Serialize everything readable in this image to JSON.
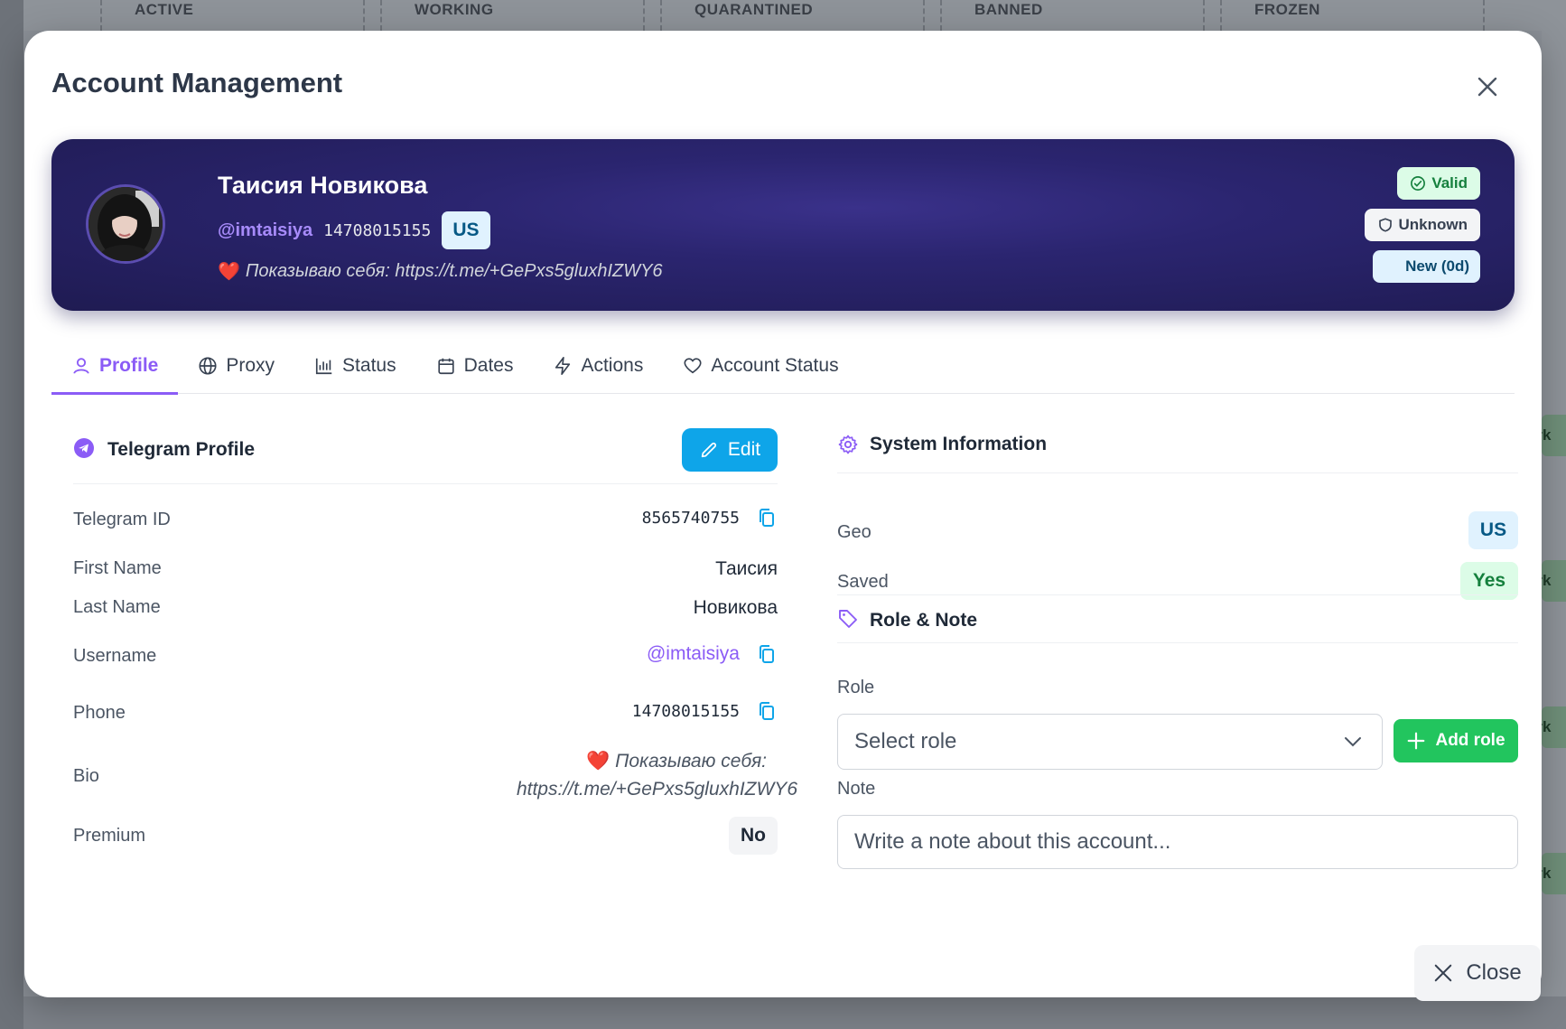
{
  "board": {
    "columns": [
      "ACTIVE",
      "WORKING",
      "QUARANTINED",
      "BANNED",
      "FROZEN"
    ],
    "side_tag": "ork"
  },
  "modal": {
    "title": "Account Management",
    "close_label": "Close"
  },
  "hero": {
    "name": "Таисия Новикова",
    "username": "@imtaisiya",
    "phone": "14708015155",
    "geo": "US",
    "bio_emoji": "❤️",
    "bio_text": "Показываю себя: https://t.me/+GePxs5gluxhIZWY6",
    "badges": {
      "valid": "Valid",
      "unknown": "Unknown",
      "new": "New (0d)"
    }
  },
  "tabs": [
    {
      "label": "Profile",
      "icon": "user-icon",
      "active": true
    },
    {
      "label": "Proxy",
      "icon": "globe-icon",
      "active": false
    },
    {
      "label": "Status",
      "icon": "bar-chart-icon",
      "active": false
    },
    {
      "label": "Dates",
      "icon": "calendar-icon",
      "active": false
    },
    {
      "label": "Actions",
      "icon": "lightning-icon",
      "active": false
    },
    {
      "label": "Account Status",
      "icon": "heart-icon",
      "active": false
    }
  ],
  "profile": {
    "section_title": "Telegram Profile",
    "edit_label": "Edit",
    "fields": {
      "telegram_id_label": "Telegram ID",
      "telegram_id": "8565740755",
      "first_name_label": "First Name",
      "first_name": "Таисия",
      "last_name_label": "Last Name",
      "last_name": "Новикова",
      "username_label": "Username",
      "username": "@imtaisiya",
      "phone_label": "Phone",
      "phone": "14708015155",
      "bio_label": "Bio",
      "bio_emoji": "❤️",
      "bio_line1": "Показываю себя:",
      "bio_line2": "https://t.me/+GePxs5gluxhIZWY6",
      "premium_label": "Premium",
      "premium": "No"
    }
  },
  "system": {
    "section_title": "System Information",
    "geo_label": "Geo",
    "geo": "US",
    "saved_label": "Saved",
    "saved": "Yes"
  },
  "role_note": {
    "section_title": "Role & Note",
    "role_label": "Role",
    "role_placeholder": "Select role",
    "add_role_label": "Add role",
    "note_label": "Note",
    "note_placeholder": "Write a note about this account..."
  },
  "colors": {
    "accent": "#8b5cf6",
    "edit": "#0ea5e9",
    "add_role": "#22c55e",
    "hero_bg": "#2b2570"
  }
}
